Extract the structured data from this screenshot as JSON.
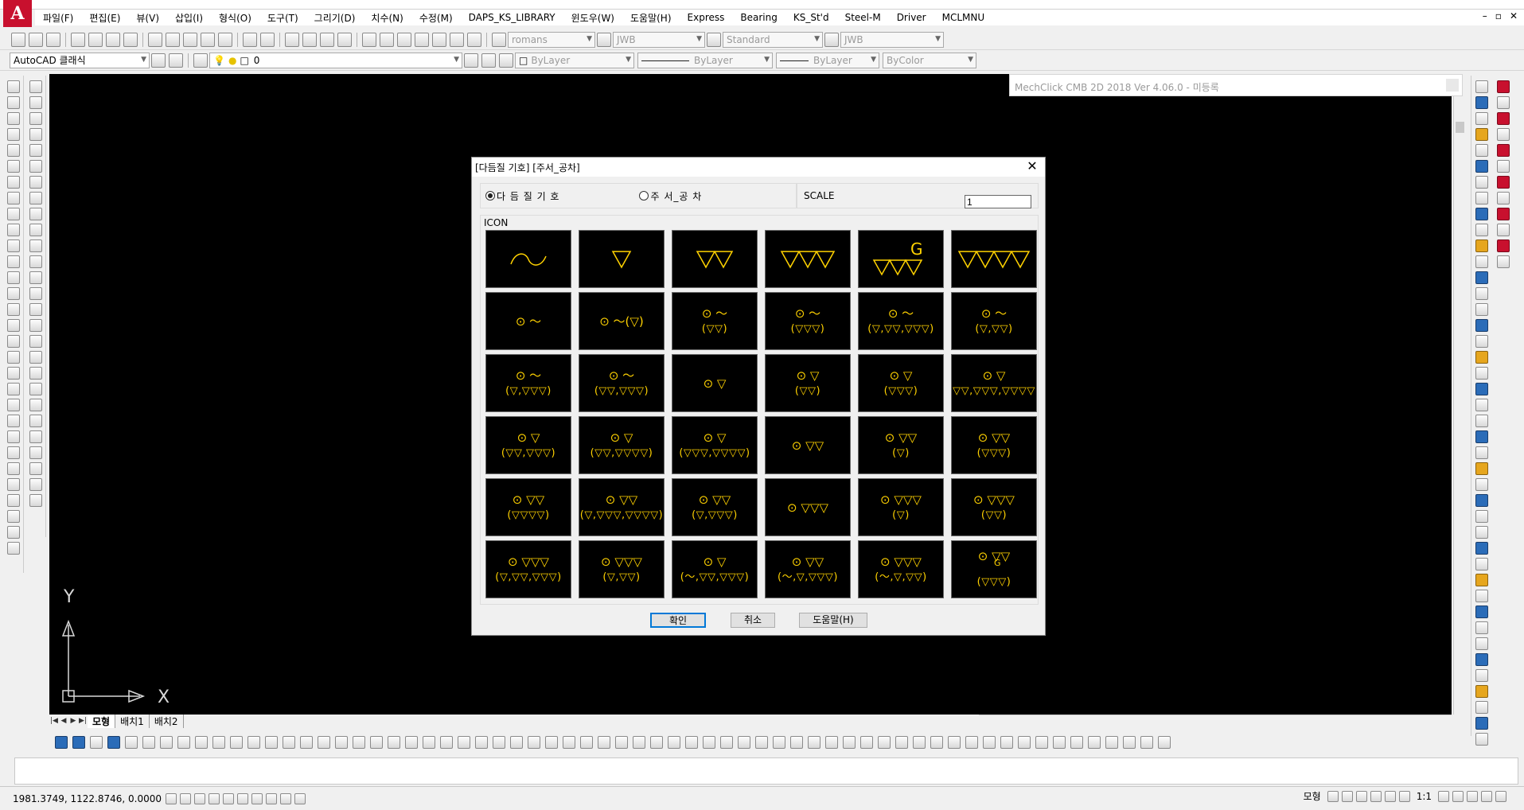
{
  "title_bar": {
    "logo": "A"
  },
  "window_controls": [
    "–",
    "▫",
    "✕"
  ],
  "menu": [
    "파일(F)",
    "편집(E)",
    "뷰(V)",
    "삽입(I)",
    "형식(O)",
    "도구(T)",
    "그리기(D)",
    "치수(N)",
    "수정(M)",
    "DAPS_KS_LIBRARY",
    "윈도우(W)",
    "도움말(H)",
    "Express",
    "Bearing",
    "KS_St'd",
    "Steel-M",
    "Driver",
    "MCLMNU"
  ],
  "toolbar1": {
    "text_style": "romans",
    "dim_style": "JWB",
    "table_style": "Standard",
    "mleader_style": "JWB"
  },
  "toolbar2": {
    "workspace": "AutoCAD 클래식",
    "layer": "0",
    "color": "ByLayer",
    "linetype": "ByLayer",
    "lineweight": "ByLayer",
    "plot_style": "ByColor"
  },
  "mechclick_banner": "MechClick CMB 2D 2018  Ver 4.06.0 - 미등록",
  "ucs": {
    "x_label": "X",
    "y_label": "Y"
  },
  "layout_tabs": {
    "tabs": [
      "모형",
      "배치1",
      "배치2"
    ],
    "active": "모형"
  },
  "status": {
    "coordinates": "1981.3749, 1122.8746, 0.0000",
    "model_label": "모형",
    "annotation_scale": "1:1"
  },
  "dialog": {
    "title": "[다듬질 기호] [주서_공차]",
    "close": "✕",
    "radio_finish": "다 듬 질 기 호",
    "radio_note": "주 서_공 차",
    "selected_radio": "finish",
    "scale_label": "SCALE",
    "scale_value": "1",
    "icon_label": "ICON",
    "ok": "확인",
    "cancel": "취소",
    "help": "도움말(H)",
    "icons": [
      {
        "kind": "wave"
      },
      {
        "kind": "tri",
        "n": 1
      },
      {
        "kind": "tri",
        "n": 2
      },
      {
        "kind": "tri",
        "n": 3
      },
      {
        "kind": "g3"
      },
      {
        "kind": "tri",
        "n": 4
      },
      {
        "top": "⊙ ～",
        "bot": ""
      },
      {
        "top": "⊙ ～(▽)",
        "bot": ""
      },
      {
        "top": "⊙ ～",
        "bot": "(▽▽)"
      },
      {
        "top": "⊙ ～",
        "bot": "(▽▽▽)"
      },
      {
        "top": "⊙ ～",
        "bot": "(▽,▽▽,▽▽▽)"
      },
      {
        "top": "⊙ ～",
        "bot": "(▽,▽▽)"
      },
      {
        "top": "⊙ ～",
        "bot": "(▽,▽▽▽)"
      },
      {
        "top": "⊙ ～",
        "bot": "(▽▽,▽▽▽)"
      },
      {
        "top": "⊙ ▽",
        "bot": ""
      },
      {
        "top": "⊙ ▽",
        "bot": "(▽▽)"
      },
      {
        "top": "⊙ ▽",
        "bot": "(▽▽▽)"
      },
      {
        "top": "⊙ ▽",
        "bot": "(▽▽,▽▽▽,▽▽▽▽)"
      },
      {
        "top": "⊙ ▽",
        "bot": "(▽▽,▽▽▽)"
      },
      {
        "top": "⊙ ▽",
        "bot": "(▽▽,▽▽▽▽)"
      },
      {
        "top": "⊙ ▽",
        "bot": "(▽▽▽,▽▽▽▽)"
      },
      {
        "top": "⊙ ▽▽",
        "bot": ""
      },
      {
        "top": "⊙ ▽▽",
        "bot": "(▽)"
      },
      {
        "top": "⊙ ▽▽",
        "bot": "(▽▽▽)"
      },
      {
        "top": "⊙ ▽▽",
        "bot": "(▽▽▽▽)"
      },
      {
        "top": "⊙ ▽▽",
        "bot": "(▽,▽▽▽,▽▽▽▽)"
      },
      {
        "top": "⊙ ▽▽",
        "bot": "(▽,▽▽▽)"
      },
      {
        "top": "⊙ ▽▽▽",
        "bot": ""
      },
      {
        "top": "⊙ ▽▽▽",
        "bot": "(▽)"
      },
      {
        "top": "⊙ ▽▽▽",
        "bot": "(▽▽)"
      },
      {
        "top": "⊙ ▽▽▽",
        "bot": "(▽,▽▽,▽▽▽)"
      },
      {
        "top": "⊙ ▽▽▽",
        "bot": "(▽,▽▽)"
      },
      {
        "top": "⊙ ▽",
        "bot": "(～,▽▽,▽▽▽)"
      },
      {
        "top": "⊙ ▽▽",
        "bot": "(～,▽,▽▽▽)"
      },
      {
        "top": "⊙ ▽▽▽",
        "bot": "(～,▽,▽▽)"
      },
      {
        "top": "⊙ ▽▽",
        "bot": "(▽▽▽)",
        "g": "G"
      }
    ]
  },
  "colors": {
    "canvas": "#000000",
    "symbol": "#ffd200",
    "accent": "#0078d7",
    "brand": "#c8102e"
  }
}
